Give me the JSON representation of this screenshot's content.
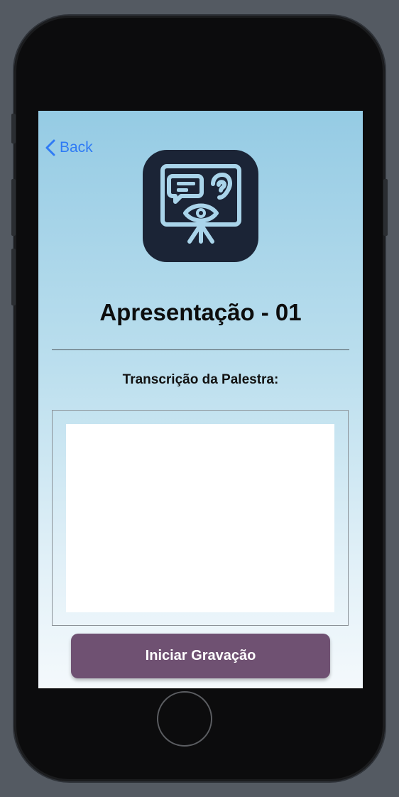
{
  "navigation": {
    "back_label": "Back"
  },
  "app_icon": {
    "name": "presentation-listen-watch-icon"
  },
  "presentation": {
    "title": "Apresentação - 01",
    "transcript_label": "Transcrição da Palestra:",
    "transcript_value": ""
  },
  "actions": {
    "record_label": "Iniciar Gravação"
  },
  "colors": {
    "accent": "#2f7bf5",
    "record_button": "#6f5172",
    "icon_background": "#1b2436",
    "icon_foreground": "#a9d4ea"
  }
}
